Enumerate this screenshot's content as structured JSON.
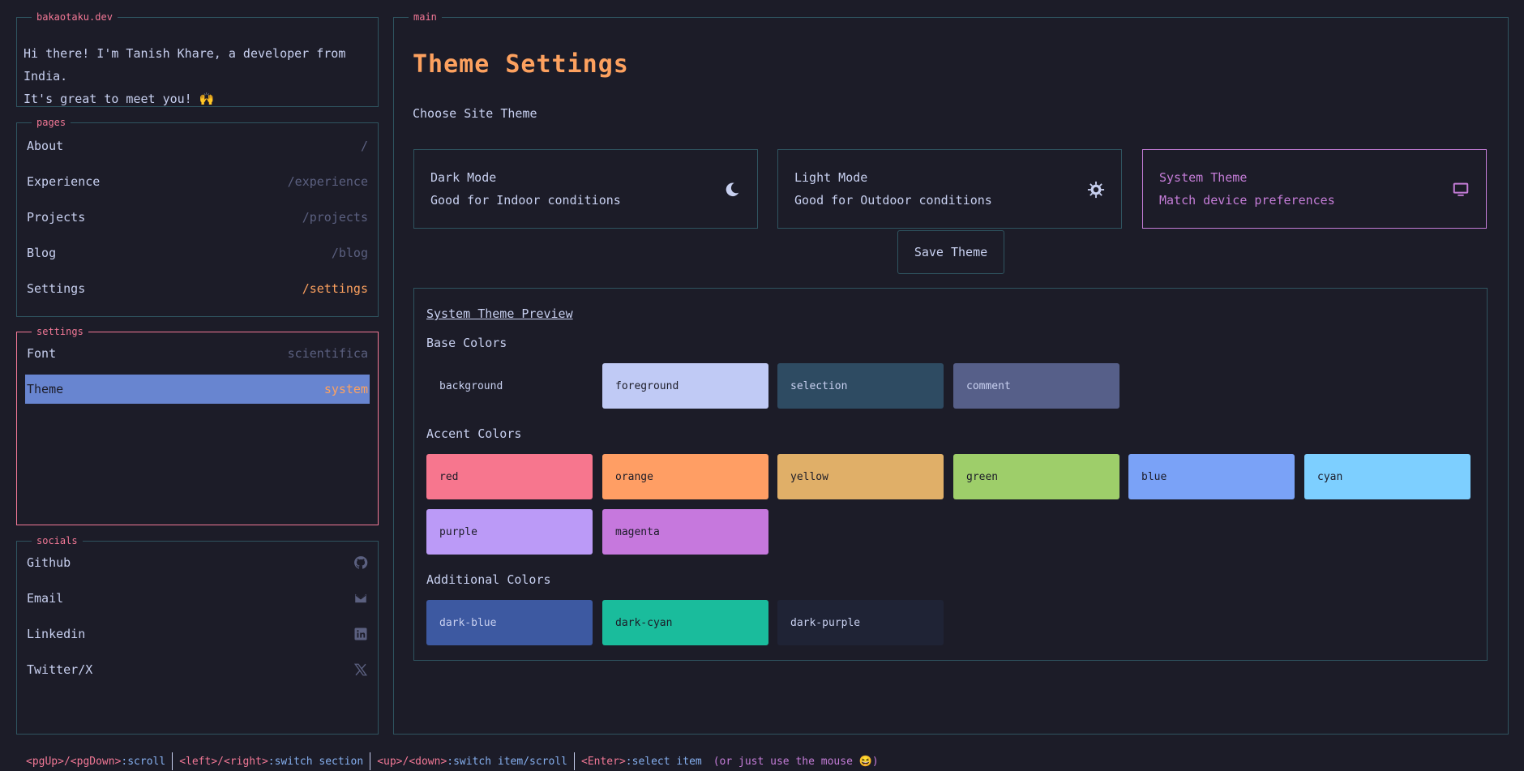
{
  "intro": {
    "legend": "bakaotaku.dev",
    "line1": "Hi there! I'm Tanish Khare, a developer from India.",
    "line2": "It's great to meet you! 🙌"
  },
  "pages": {
    "legend": "pages",
    "items": [
      {
        "label": "About",
        "path": "/"
      },
      {
        "label": "Experience",
        "path": "/experience"
      },
      {
        "label": "Projects",
        "path": "/projects"
      },
      {
        "label": "Blog",
        "path": "/blog"
      },
      {
        "label": "Settings",
        "path": "/settings"
      }
    ]
  },
  "settings": {
    "legend": "settings",
    "items": [
      {
        "label": "Font",
        "value": "scientifica"
      },
      {
        "label": "Theme",
        "value": "system"
      }
    ]
  },
  "socials": {
    "legend": "socials",
    "items": [
      {
        "label": "Github",
        "icon": "github-icon"
      },
      {
        "label": "Email",
        "icon": "mail-icon"
      },
      {
        "label": "Linkedin",
        "icon": "linkedin-icon"
      },
      {
        "label": "Twitter/X",
        "icon": "x-icon"
      }
    ]
  },
  "main": {
    "legend": "main",
    "title": "Theme Settings",
    "choose_label": "Choose Site Theme",
    "themes": [
      {
        "title": "Dark Mode",
        "desc": "Good for Indoor conditions",
        "icon": "moon-icon"
      },
      {
        "title": "Light Mode",
        "desc": "Good for Outdoor conditions",
        "icon": "sun-icon"
      },
      {
        "title": "System Theme",
        "desc": "Match device preferences",
        "icon": "monitor-icon"
      }
    ],
    "save_label": "Save Theme",
    "preview": {
      "title": "System Theme Preview",
      "base_label": "Base Colors",
      "accent_label": "Accent Colors",
      "additional_label": "Additional Colors",
      "base": [
        {
          "name": "background",
          "color": "#1c1c28"
        },
        {
          "name": "foreground",
          "color": "#c0caf5"
        },
        {
          "name": "selection",
          "color": "#2e4b62"
        },
        {
          "name": "comment",
          "color": "#565f89"
        }
      ],
      "accent": [
        {
          "name": "red",
          "color": "#f7768e"
        },
        {
          "name": "orange",
          "color": "#ff9e64"
        },
        {
          "name": "yellow",
          "color": "#e0af68"
        },
        {
          "name": "green",
          "color": "#9ece6a"
        },
        {
          "name": "blue",
          "color": "#7aa2f7"
        },
        {
          "name": "cyan",
          "color": "#7dcfff"
        },
        {
          "name": "purple",
          "color": "#bb9af7"
        },
        {
          "name": "magenta",
          "color": "#c678dd"
        }
      ],
      "additional": [
        {
          "name": "dark-blue",
          "color": "#3d59a1"
        },
        {
          "name": "dark-cyan",
          "color": "#1abc9c"
        },
        {
          "name": "dark-purple",
          "color": "#1f2335"
        }
      ]
    }
  },
  "footer": {
    "segments": [
      {
        "key": "<pgUp>/<pgDown>",
        "desc": ":scroll"
      },
      {
        "key": "<left>/<right>",
        "desc": ":switch section"
      },
      {
        "key": "<up>/<down>",
        "desc": ":switch item/scroll"
      },
      {
        "key": "<Enter>",
        "desc": ":select item"
      }
    ],
    "hint": "(or just use the mouse 😆)"
  },
  "colors": {
    "bg": "#1c1c28",
    "border": "#2f5460",
    "accent_pink": "#f27896",
    "accent_orange": "#fda15f",
    "accent_purple": "#c57dd8",
    "selected_bg": "#6885d0"
  }
}
